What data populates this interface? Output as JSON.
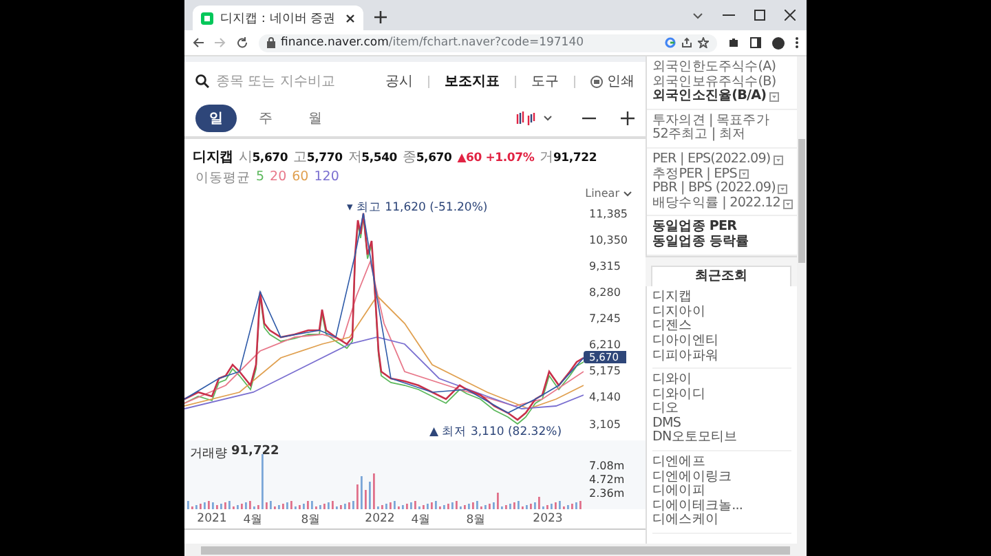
{
  "browser": {
    "tab_title": "디지캡 : 네이버 증권",
    "url_host": "finance.naver.com",
    "url_path": "/item/fchart.naver?code=197140"
  },
  "toolbar": {
    "search_placeholder": "종목 또는 지수비교",
    "menu": [
      {
        "label": "공시",
        "selected": false
      },
      {
        "label": "보조지표",
        "selected": true
      },
      {
        "label": "도구",
        "selected": false
      }
    ],
    "print": "인쇄",
    "periods": [
      {
        "label": "일",
        "selected": true
      },
      {
        "label": "주",
        "selected": false
      },
      {
        "label": "월",
        "selected": false
      }
    ]
  },
  "quote": {
    "name": "디지캡",
    "fields": [
      {
        "label": "시",
        "value": "5,670"
      },
      {
        "label": "고",
        "value": "5,770"
      },
      {
        "label": "저",
        "value": "5,540"
      },
      {
        "label": "종",
        "value": "5,670"
      }
    ],
    "change": "▲60",
    "change_pct": "+1.07%",
    "volume_label": "거",
    "volume": "91,722"
  },
  "moving_average": {
    "label": "이동평균",
    "lines": [
      {
        "label": "5",
        "color": "#5cb85c"
      },
      {
        "label": "20",
        "color": "#e8788a"
      },
      {
        "label": "60",
        "color": "#e0a050"
      },
      {
        "label": "120",
        "color": "#7a6fd0"
      }
    ]
  },
  "scale": "Linear",
  "price_axis": [
    "11,385",
    "10,350",
    "9,315",
    "8,280",
    "7,245",
    "6,210",
    "5,175",
    "4,140",
    "3,105"
  ],
  "current_price": "5,670",
  "high_note": "▾ 최고 11,620 (-51.20%)",
  "low_note": "▲ 최저 3,110 (82.32%)",
  "volume_panel": {
    "label": "거래량",
    "value": "91,722",
    "ticks": [
      "7.08m",
      "4.72m",
      "2.36m"
    ]
  },
  "x_labels": [
    "2021",
    "4월",
    "8월",
    "2022",
    "4월",
    "8월",
    "2023"
  ],
  "sidebar": {
    "info_groups": [
      [
        {
          "text": "외국인한도주식수(A)",
          "bold": false,
          "icon": false
        },
        {
          "text": "외국인보유주식수(B)",
          "bold": false,
          "icon": false
        },
        {
          "text": "외국인소진율(B/A)",
          "bold": true,
          "icon": true
        }
      ],
      [
        {
          "text": "투자의견 | 목표주가",
          "bold": false,
          "icon": false
        },
        {
          "text": "52주최고 | 최저",
          "bold": false,
          "icon": false
        }
      ],
      [
        {
          "text": "PER | EPS(2022.09)",
          "bold": false,
          "icon": true
        },
        {
          "text": "추정PER | EPS",
          "bold": false,
          "icon": true
        },
        {
          "text": "PBR | BPS (2022.09)",
          "bold": false,
          "icon": true
        },
        {
          "text": "배당수익률 | 2022.12",
          "bold": false,
          "icon": true
        }
      ],
      [
        {
          "text": "동일업종 PER",
          "bold": true,
          "icon": false
        },
        {
          "text": "동일업종 등락률",
          "bold": true,
          "icon": false
        }
      ]
    ],
    "recent_title": "최근조회",
    "recent_groups": [
      [
        "디지캡",
        "디지아이",
        "디젠스",
        "디아이엔티",
        "디피아파워"
      ],
      [
        "디와이",
        "디와이디",
        "디오",
        "DMS",
        "DN오토모티브"
      ],
      [
        "디엔에프",
        "디엔에이링크",
        "디에이피",
        "디에이테크놀...",
        "디에스케이"
      ]
    ]
  }
}
